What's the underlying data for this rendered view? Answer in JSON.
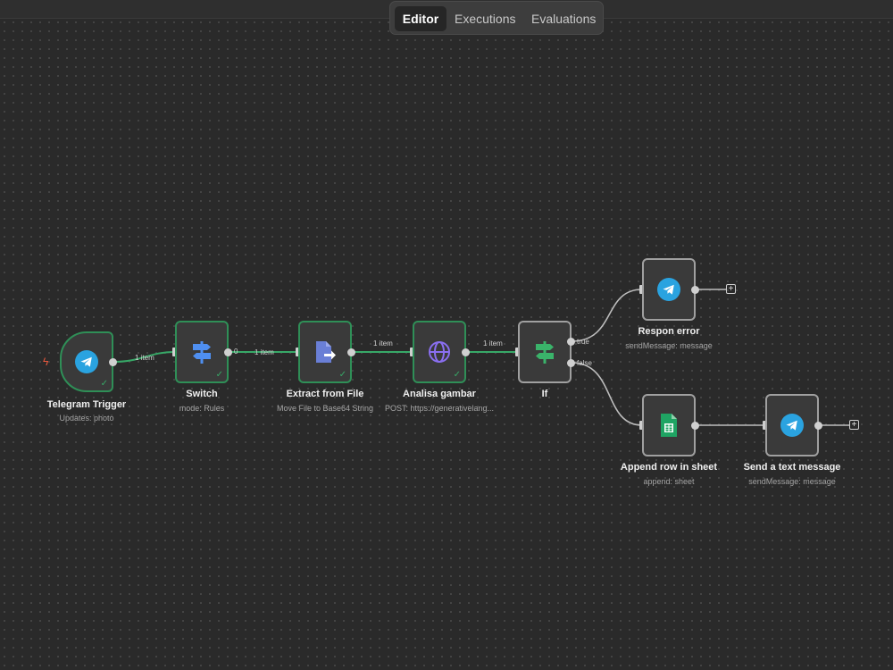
{
  "tabs": {
    "editor": "Editor",
    "executions": "Executions",
    "evaluations": "Evaluations"
  },
  "nodes": {
    "telegram_trigger": {
      "title": "Telegram Trigger",
      "subtitle": "Updates: photo",
      "icon": "telegram-icon"
    },
    "switch": {
      "title": "Switch",
      "subtitle": "mode: Rules",
      "icon": "switch-icon"
    },
    "extract": {
      "title": "Extract from File",
      "subtitle": "Move File to Base64 String",
      "icon": "file-export-icon"
    },
    "analisa": {
      "title": "Analisa gambar",
      "subtitle": "POST: https://generativelang...",
      "icon": "globe-icon"
    },
    "if": {
      "title": "If",
      "subtitle": "",
      "icon": "if-icon"
    },
    "respon_error": {
      "title": "Respon error",
      "subtitle": "sendMessage: message",
      "icon": "telegram-icon"
    },
    "append_row": {
      "title": "Append row in sheet",
      "subtitle": "append: sheet",
      "icon": "google-sheets-icon"
    },
    "send_text": {
      "title": "Send a text message",
      "subtitle": "sendMessage: message",
      "icon": "telegram-icon"
    }
  },
  "connections": {
    "trigger_switch": "1 item",
    "switch_output": "0",
    "switch_extract": "1 item",
    "extract_analisa": "1 item",
    "analisa_if": "1 item",
    "if_true": "true",
    "if_false": "false"
  },
  "colors": {
    "success": "#2f8f57",
    "telegram": "#2aa3e0",
    "sheets": "#1fa463",
    "globe": "#8a6ff0",
    "switch": "#4f8ff0",
    "if": "#3ab36a",
    "trigger_bolt": "#e8583d"
  }
}
